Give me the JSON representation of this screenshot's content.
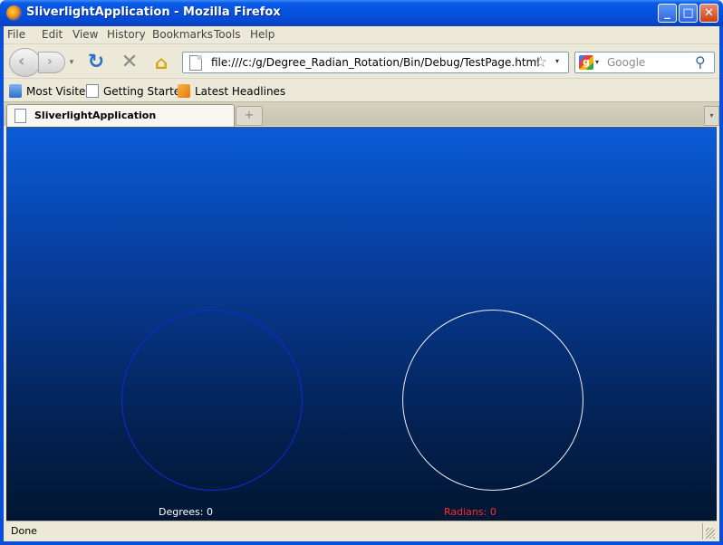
{
  "window": {
    "title": "SliverlightApplication - Mozilla Firefox",
    "controls": {
      "minimize": "_",
      "maximize": "□",
      "close": "✕"
    }
  },
  "menu": [
    "File",
    "Edit",
    "View",
    "History",
    "Bookmarks",
    "Tools",
    "Help"
  ],
  "nav": {
    "back_glyph": "‹",
    "forward_glyph": "›",
    "dropdown_glyph": "▾",
    "reload_glyph": "↻",
    "stop_glyph": "✕",
    "home_glyph": "⌂",
    "url": "file:///c:/g/Degree_Radian_Rotation/Bin/Debug/TestPage.html",
    "star_glyph": "☆",
    "search_engine_glyph": "g",
    "search_placeholder": "Google",
    "search_glyph": "⚲"
  },
  "bookmarks": [
    {
      "label": "Most Visited",
      "icon": "folder-icon"
    },
    {
      "label": "Getting Started",
      "icon": "page-icon"
    },
    {
      "label": "Latest Headlines",
      "icon": "rss-icon"
    }
  ],
  "tabs": {
    "active_label": "SliverlightApplication",
    "new_tab_glyph": "+",
    "all_tabs_glyph": "▾"
  },
  "app": {
    "degrees_readout": "Degrees: 0",
    "radians_readout": "Radians: 0",
    "colors": {
      "degrees_circle": "#1428d8",
      "radians_circle": "#f2f2f2",
      "degrees_text": "#ffffff",
      "radians_text": "#ff2a2a"
    }
  },
  "status": {
    "text": "Done"
  }
}
